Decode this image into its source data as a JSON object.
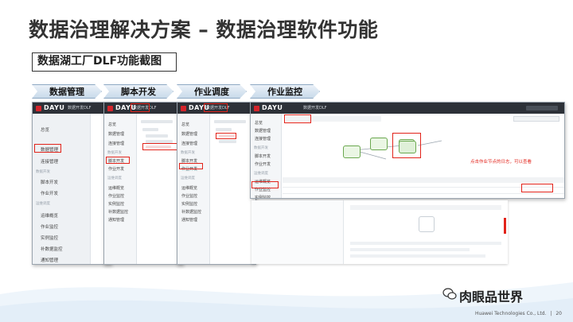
{
  "slide": {
    "title": "数据治理解决方案 – 数据治理软件功能",
    "subtitle": "数据湖工厂DLF功能截图",
    "steps": [
      "数据管理",
      "脚本开发",
      "作业调度",
      "作业监控"
    ]
  },
  "screens": {
    "logo": "DAYU",
    "project": "数据开发DLF",
    "nav_sections": [
      "数据开发",
      "运维调度"
    ],
    "nav_items": [
      "总览",
      "连接管理",
      "数据管理",
      "脚本开发",
      "作业开发",
      "运维概览",
      "作业监控",
      "实例监控",
      "补数据监控",
      "通知管理"
    ],
    "monitor": {
      "annotation": "点击作业节点的日志，可以查看"
    }
  },
  "footer": {
    "watermark": "肉眼品世界",
    "copyright": "Huawei Technologies Co., Ltd.",
    "separator": "|",
    "page": "20"
  },
  "colors": {
    "accent_red": "#e2231a",
    "topbar": "#2d3138",
    "step_fill": "#c9daea"
  }
}
